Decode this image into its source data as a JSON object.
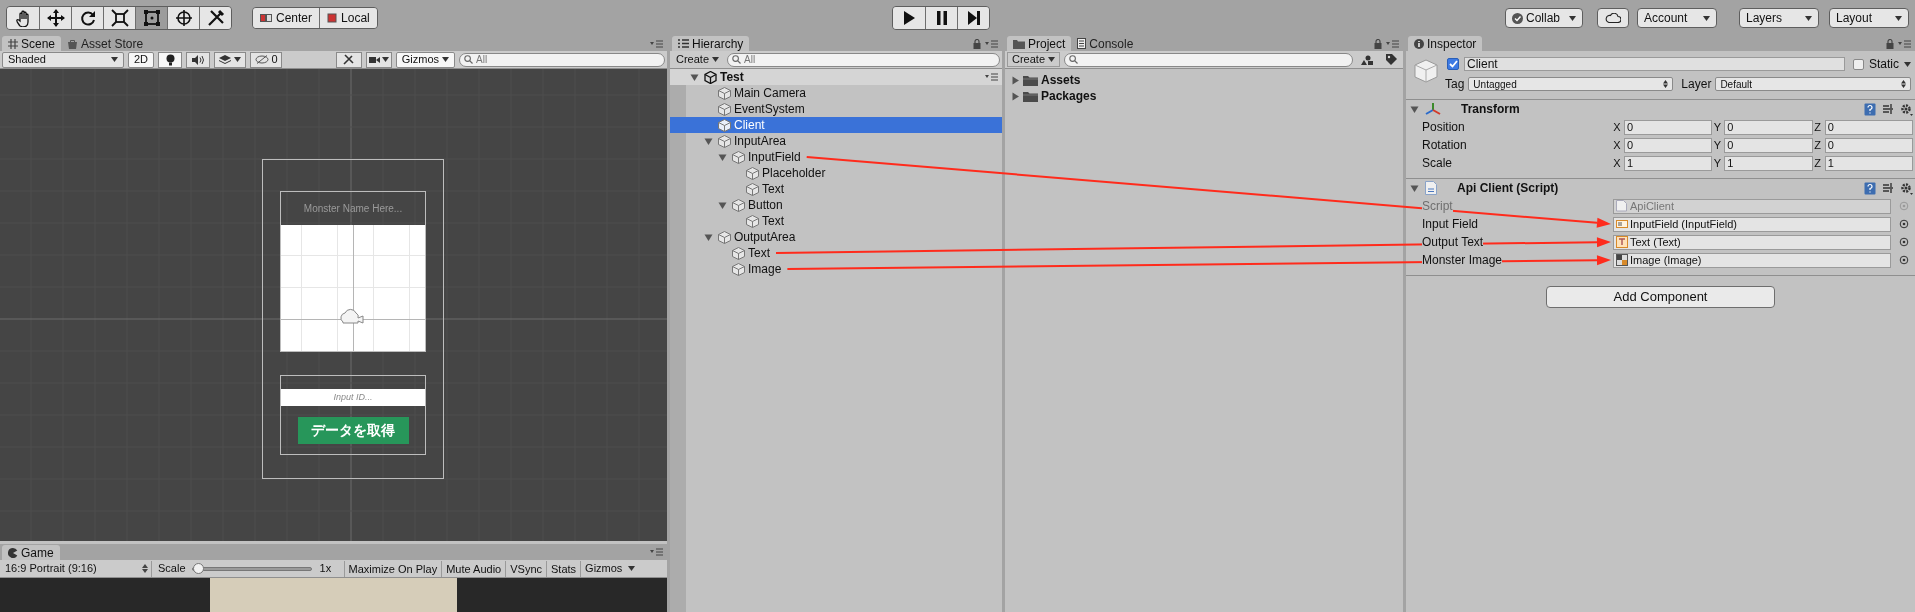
{
  "toolbar": {
    "tools": [
      {
        "kind": "hand",
        "selected": false
      },
      {
        "kind": "move",
        "selected": false
      },
      {
        "kind": "rotate",
        "selected": false
      },
      {
        "kind": "scale",
        "selected": false
      },
      {
        "kind": "rect",
        "selected": true
      },
      {
        "kind": "transform",
        "selected": false
      },
      {
        "kind": "custom",
        "selected": false
      }
    ],
    "pivot": [
      "Center",
      "Local"
    ],
    "play": [
      {
        "kind": "play"
      },
      {
        "kind": "pause"
      },
      {
        "kind": "step"
      }
    ],
    "right": [
      {
        "kind": "collab",
        "label": "Collab"
      },
      {
        "kind": "cloud"
      },
      {
        "kind": "dropdown",
        "label": "Account"
      },
      {
        "kind": "dropdown",
        "label": "Layers"
      },
      {
        "kind": "dropdown",
        "label": "Layout"
      }
    ]
  },
  "scene": {
    "tabs": [
      {
        "label": "Scene",
        "selected": true
      },
      {
        "label": "Asset Store",
        "selected": false
      }
    ],
    "toolbar": {
      "shading": "Shaded",
      "mode": "2D",
      "hidden_count": "0",
      "gizmos": "Gizmos",
      "search_placeholder": "All"
    },
    "canvas": {
      "name_placeholder": "Monster Name Here...",
      "input_placeholder": "Input ID...",
      "button": "データを取得"
    }
  },
  "game": {
    "tab": "Game",
    "aspect": "16:9 Portrait (9:16)",
    "scale_label": "Scale",
    "scale": {
      "level": 0
    },
    "scale_reading": "1x",
    "toggles": [
      "Maximize On Play",
      "Mute Audio",
      "VSync",
      "Stats"
    ],
    "gizmos": "Gizmos"
  },
  "hierarchy": {
    "tab": "Hierarchy",
    "create": "Create",
    "search_placeholder": "All",
    "tree": [
      {
        "label": "Test",
        "kind": "scene",
        "expanded": true,
        "selected": false,
        "children": [
          {
            "label": "Main Camera",
            "kind": "object",
            "selected": false
          },
          {
            "label": "EventSystem",
            "kind": "object",
            "selected": false
          },
          {
            "label": "Client",
            "kind": "object",
            "selected": true
          },
          {
            "label": "InputArea",
            "kind": "object",
            "expanded": true,
            "selected": false,
            "children": [
              {
                "label": "InputField",
                "kind": "object",
                "expanded": true,
                "selected": false,
                "children": [
                  {
                    "label": "Placeholder",
                    "kind": "object",
                    "selected": false
                  },
                  {
                    "label": "Text",
                    "kind": "object",
                    "selected": false
                  }
                ]
              },
              {
                "label": "Button",
                "kind": "object",
                "expanded": true,
                "selected": false,
                "children": [
                  {
                    "label": "Text",
                    "kind": "object",
                    "selected": false
                  }
                ]
              }
            ]
          },
          {
            "label": "OutputArea",
            "kind": "object",
            "expanded": true,
            "selected": false,
            "children": [
              {
                "label": "Text",
                "kind": "object",
                "selected": false
              },
              {
                "label": "Image",
                "kind": "object",
                "selected": false
              }
            ]
          }
        ]
      }
    ]
  },
  "project": {
    "tabs": [
      {
        "label": "Project",
        "selected": true
      },
      {
        "label": "Console",
        "selected": false
      }
    ],
    "create": "Create",
    "items": [
      {
        "label": "Assets",
        "expanded": false
      },
      {
        "label": "Packages",
        "expanded": false
      }
    ]
  },
  "inspector": {
    "tab": "Inspector",
    "object": {
      "active": true,
      "name": "Client",
      "static": false,
      "static_label": "Static",
      "tag_label": "Tag",
      "tag": "Untagged",
      "layer_label": "Layer",
      "layer": "Default"
    },
    "components": [
      {
        "kind": "transform",
        "title": "Transform",
        "expanded": true,
        "rows": [
          {
            "label": "Position",
            "values": [
              {
                "axis": "X",
                "value": "0"
              },
              {
                "axis": "Y",
                "value": "0"
              },
              {
                "axis": "Z",
                "value": "0"
              }
            ]
          },
          {
            "label": "Rotation",
            "values": [
              {
                "axis": "X",
                "value": "0"
              },
              {
                "axis": "Y",
                "value": "0"
              },
              {
                "axis": "Z",
                "value": "0"
              }
            ]
          },
          {
            "label": "Scale",
            "values": [
              {
                "axis": "X",
                "value": "1"
              },
              {
                "axis": "Y",
                "value": "1"
              },
              {
                "axis": "Z",
                "value": "1"
              }
            ]
          }
        ]
      },
      {
        "kind": "script",
        "title": "Api Client (Script)",
        "expanded": true,
        "fields": [
          {
            "label": "Script",
            "value": "ApiClient",
            "kind": "script",
            "disabled": true
          },
          {
            "label": "Input Field",
            "value": "InputField (InputField)",
            "kind": "input",
            "disabled": false
          },
          {
            "label": "Output Text",
            "value": "Text (Text)",
            "kind": "text",
            "disabled": false
          },
          {
            "label": "Monster Image",
            "value": "Image (Image)",
            "kind": "image",
            "disabled": false
          }
        ]
      }
    ],
    "add_button": "Add Component"
  }
}
